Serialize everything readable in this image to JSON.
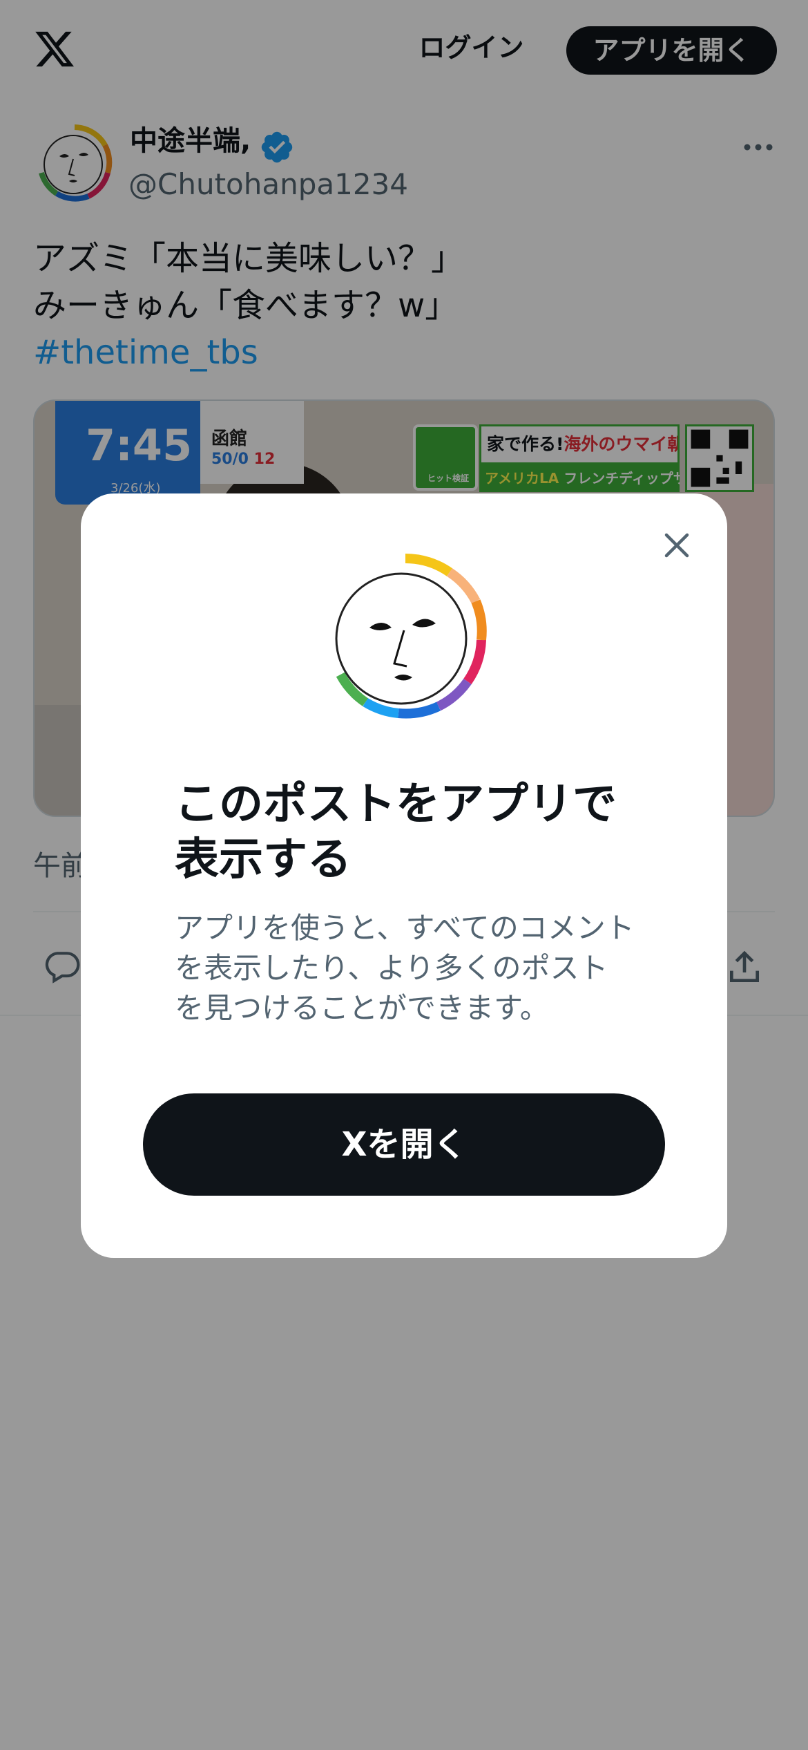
{
  "header": {
    "login_label": "ログイン",
    "open_app_label": "アプリを開く"
  },
  "post": {
    "author_name": "中途半端,",
    "author_handle": "@Chutohanpa1234",
    "text_lines": [
      "アズミ「本当に美味しい？」",
      "みーきゅん「食べます？w」"
    ],
    "hashtag": "#thetime_tbs",
    "timestamp_partial": "午前",
    "media": {
      "clock": "7:45",
      "date": "3/26(水)",
      "city": "函館",
      "temp_low": "50/0",
      "temp_high": "12",
      "banner_icon_label": "ヒット検証",
      "banner_top_prefix": "家で作る!",
      "banner_top_highlight": "海外のウマイ朝ごはん",
      "banner_bottom_prefix": "アメリカLA",
      "banner_bottom_highlight": "フレンチディップサンド"
    }
  },
  "modal": {
    "title_line1": "このポストをアプリで",
    "title_line2": "表示する",
    "description_line1": "アプリを使うと、すべてのコメント",
    "description_line2": "を表示したり、より多くのポスト",
    "description_line3": "を見つけることができます。",
    "cta_label": "Xを開く"
  },
  "colors": {
    "brand_dark": "#0f1419",
    "link_blue": "#1d9bf0",
    "secondary_text": "#536471",
    "verified_blue": "#1d9bf0"
  },
  "icons": [
    "x-logo-icon",
    "verified-badge-icon",
    "more-icon",
    "reply-icon",
    "share-icon",
    "close-icon"
  ]
}
